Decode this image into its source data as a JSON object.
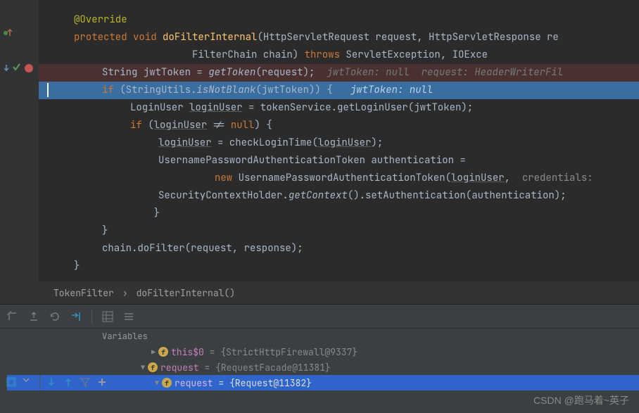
{
  "code": {
    "l1": "@Override",
    "l2_protected": "protected",
    "l2_void": "void",
    "l2_fn": "doFilterInternal",
    "l2_rest": "(HttpServletRequest request, HttpServletResponse re",
    "l3": "                    FilterChain chain) ",
    "l3_throws": "throws",
    "l3_rest": " ServletException, IOExce",
    "l4_a": "String jwtToken = ",
    "l4_fn": "getToken",
    "l4_b": "(request);  ",
    "l4_hint": "jwtToken: null  request: HeaderWriterFil",
    "l5_if": "if",
    "l5_a": " (StringUtils.",
    "l5_fn": "isNotBlank",
    "l5_b": "(jwtToken)) {   ",
    "l5_hint": "jwtToken: null",
    "l6_a": "LoginUser ",
    "l6_u": "loginUser",
    "l6_b": " = tokenService.getLoginUser(jwtToken);",
    "l7_if": "if",
    "l7_a": " (",
    "l7_u": "loginUser",
    "l7_b": " != ",
    "l7_null": "null",
    "l7_c": ") {",
    "l8_u1": "loginUser",
    "l8_a": " = checkLoginTime(",
    "l8_u2": "loginUser",
    "l8_b": ");",
    "l9": "UsernamePasswordAuthenticationToken authentication =",
    "l10_new": "new",
    "l10_a": " UsernamePasswordAuthenticationToken(",
    "l10_u": "loginUser",
    "l10_b": ",  ",
    "l10_hint": "credentials:",
    "l11_a": "SecurityContextHolder.",
    "l11_fn": "getContext",
    "l11_b": "().setAuthentication(authentication);",
    "l12": "    }",
    "l13": "}",
    "l14_a": "chain.doFilter(request, response);",
    "l15": "}"
  },
  "breadcrumb": {
    "c1": "TokenFilter",
    "c2": "doFilterInternal()"
  },
  "variables": {
    "header": "Variables",
    "r1": {
      "name": "this$0",
      "val": " = {StrictHttpFirewall@9337}"
    },
    "r2": {
      "name": "request",
      "val": " = {RequestFacade@11381}"
    },
    "r3": {
      "name": "request",
      "val": " = {Request@11382}"
    }
  },
  "watermark": "CSDN @跑马着~英子"
}
